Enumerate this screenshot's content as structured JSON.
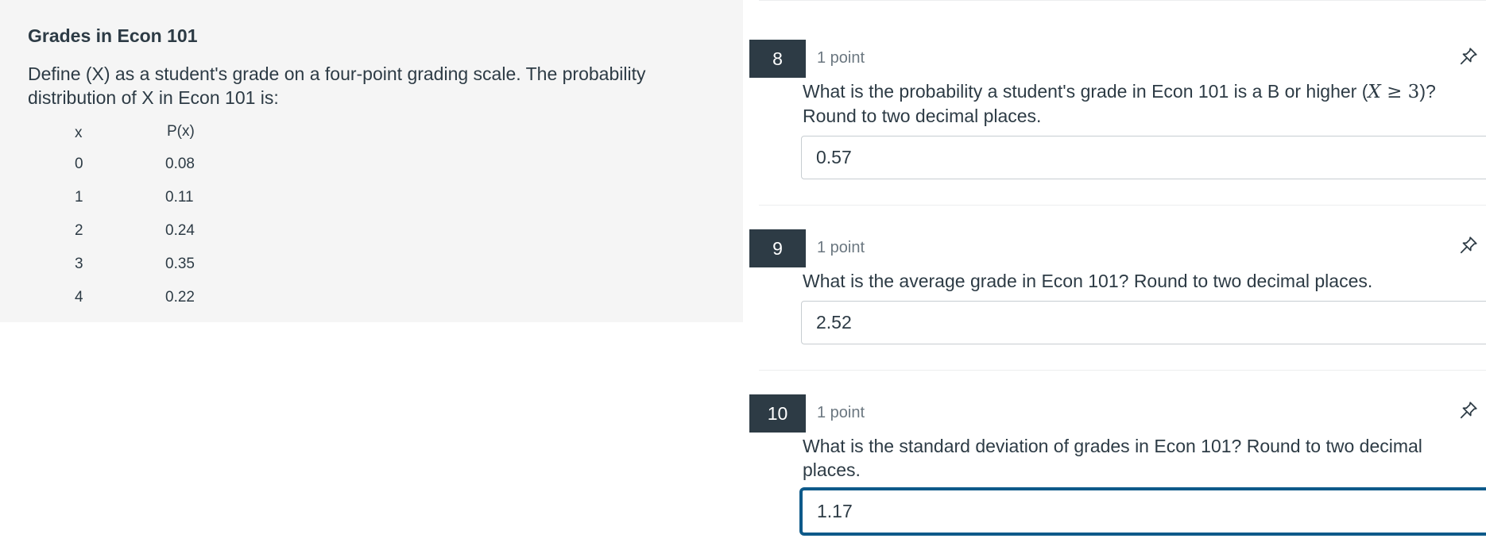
{
  "stimulus": {
    "title": "Grades in Econ 101",
    "description": "Define (X) as a student's grade on a four-point grading scale. The probability distribution of X in Econ 101 is:",
    "table": {
      "headers": [
        "x",
        "P(x)"
      ],
      "rows": [
        [
          "0",
          "0.08"
        ],
        [
          "1",
          "0.11"
        ],
        [
          "2",
          "0.24"
        ],
        [
          "3",
          "0.35"
        ],
        [
          "4",
          "0.22"
        ]
      ]
    }
  },
  "questions": [
    {
      "number": "8",
      "points": "1 point",
      "text_before": "What is the probability a student's grade in Econ 101 is a B or higher (",
      "math_var": "X",
      "math_rest": " ≥ 3",
      "text_after": ")? Round to two decimal places.",
      "answer": "0.57",
      "pin_icon": "pin-icon"
    },
    {
      "number": "9",
      "points": "1 point",
      "text": "What is the average grade in Econ 101? Round to two decimal places.",
      "answer": "2.52",
      "pin_icon": "pin-icon"
    },
    {
      "number": "10",
      "points": "1 point",
      "text": "What is the standard deviation of grades in Econ 101? Round to two decimal places.",
      "answer": "1.17",
      "pin_icon": "pin-icon"
    }
  ],
  "colors": {
    "question_badge": "#2d3b45",
    "focus_ring": "#0e5a8a",
    "stimulus_bg": "#f5f5f5"
  }
}
